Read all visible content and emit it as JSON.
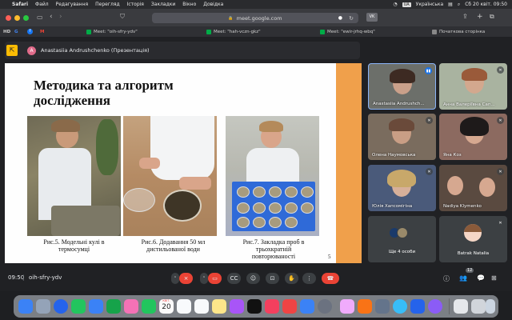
{
  "menubar": {
    "apple": "",
    "app": "Safari",
    "items": [
      "Файл",
      "Редагування",
      "Перегляд",
      "Історія",
      "Закладки",
      "Вікно",
      "Довідка"
    ],
    "input_source": "Українська",
    "datetime": "Сб 20 квіт. 09:50"
  },
  "browser": {
    "url": "meet.google.com",
    "tabs": [
      {
        "label": "Meet: \"oih-sfry-ydv\""
      },
      {
        "label": "Meet: \"hah-vczn-gkz\""
      },
      {
        "label": "Meet: \"ewir-jrhq-wbq\""
      },
      {
        "label": "Початкова сторінка"
      }
    ],
    "favorites": [
      "HD",
      "G",
      "f",
      "M"
    ]
  },
  "meet": {
    "presenter_initial": "A",
    "presenter_label": "Anastasiia Andrushchenko (Презентація)",
    "slide": {
      "title_line1": "Методика та алгоритм",
      "title_line2": "дослідження",
      "captions": [
        {
          "l1": "Рис.5. Модельні кулі в",
          "l2": "термосумці",
          "l3": ""
        },
        {
          "l1": "Рис.6. Додавання  50 мл",
          "l2": "дистильованої води",
          "l3": ""
        },
        {
          "l1": "Рис.7. Закладка проб в",
          "l2": "трьохкратній",
          "l3": "повторюваності"
        }
      ],
      "page_number": "5",
      "accent_color": "#f0a04b"
    },
    "participants": [
      {
        "name": "Anastasiia Andrushch..."
      },
      {
        "name": "Анна Валеріївна Сап..."
      },
      {
        "name": "Олена Наумовська"
      },
      {
        "name": "Яна Коз"
      },
      {
        "name": "Юлія Хапсомігіна"
      },
      {
        "name": "Nadiya Klymenko"
      },
      {
        "name": "Ще 4 особи"
      },
      {
        "name": "Batrak Natalia"
      }
    ],
    "time": "09:50",
    "meeting_code": "oih-sfry-ydv",
    "participant_count": "12"
  },
  "dock": {
    "calendar_month": "КВІТ.",
    "calendar_day": "20"
  }
}
